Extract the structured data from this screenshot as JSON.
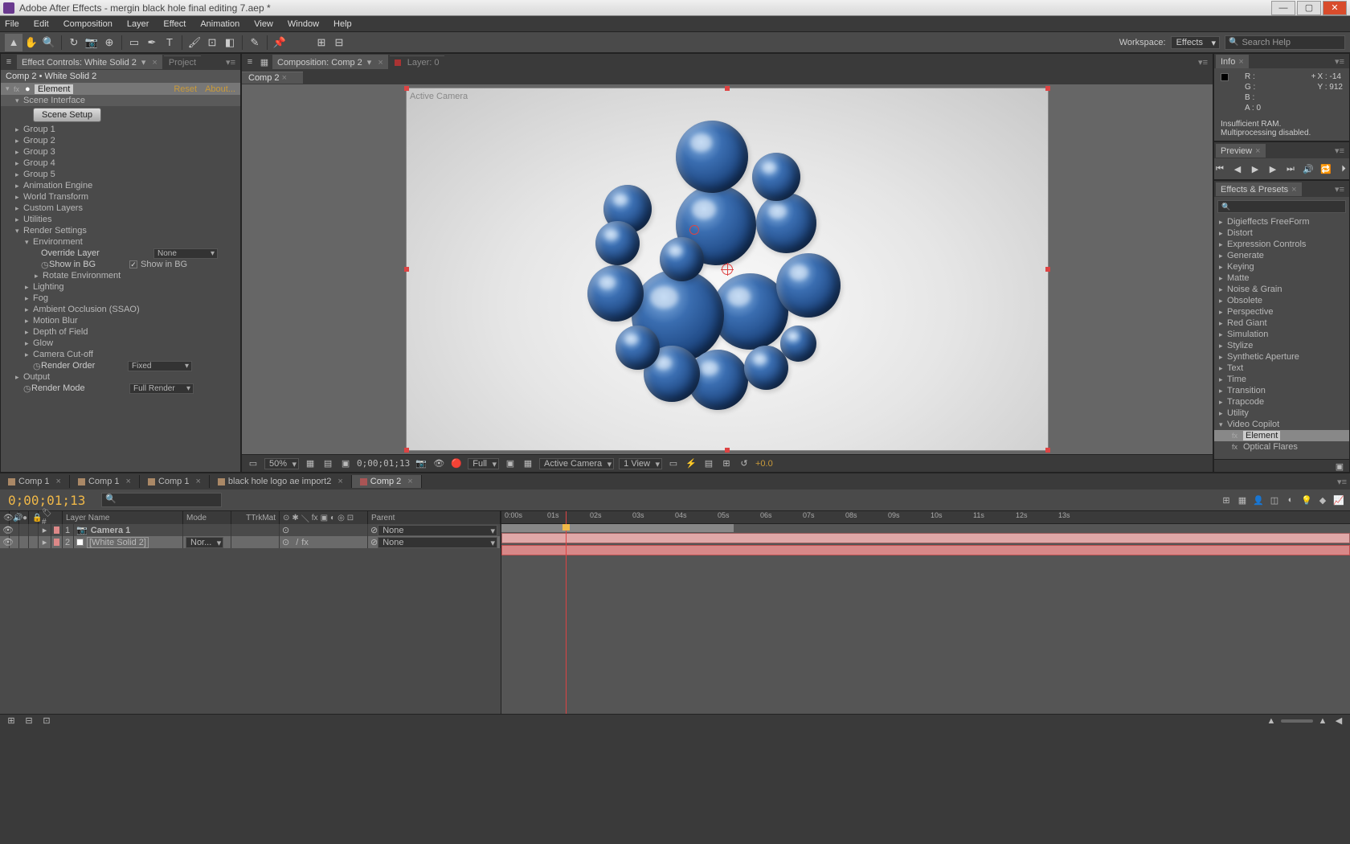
{
  "app": {
    "title": "Adobe After Effects - mergin black hole final editing 7.aep *"
  },
  "menu": [
    "File",
    "Edit",
    "Composition",
    "Layer",
    "Effect",
    "Animation",
    "View",
    "Window",
    "Help"
  ],
  "workspace": {
    "label": "Workspace:",
    "value": "Effects"
  },
  "search": {
    "placeholder": "Search Help"
  },
  "effctl": {
    "tabTitle": "Effect Controls: White Solid 2",
    "projectTab": "Project",
    "breadcrumb": "Comp 2 • White Solid 2",
    "effectName": "Element",
    "reset": "Reset",
    "about": "About...",
    "sceneInterface": "Scene Interface",
    "sceneSetup": "Scene Setup",
    "groups": [
      "Group 1",
      "Group 2",
      "Group 3",
      "Group 4",
      "Group 5"
    ],
    "props": [
      "Animation Engine",
      "World Transform",
      "Custom Layers",
      "Utilities"
    ],
    "renderSettings": "Render Settings",
    "environment": "Environment",
    "overrideLayer": "Override Layer",
    "overrideLayerVal": "None",
    "showInBG": "Show in BG",
    "showInBGVal": "Show in BG",
    "rotateEnv": "Rotate Environment",
    "rs_items": [
      "Lighting",
      "Fog",
      "Ambient Occlusion (SSAO)",
      "Motion Blur",
      "Depth of Field",
      "Glow",
      "Camera Cut-off"
    ],
    "renderOrder": "Render Order",
    "renderOrderVal": "Fixed",
    "output": "Output",
    "renderMode": "Render Mode",
    "renderModeVal": "Full Render"
  },
  "comp": {
    "tabTitle": "Composition: Comp 2",
    "layerTab": "Layer:  0",
    "subTab": "Comp 2",
    "activeCamera": "Active Camera",
    "zoom": "50%",
    "timecode": "0;00;01;13",
    "resolution": "Full",
    "view": "Active Camera",
    "viewLayout": "1 View",
    "exposure": "+0.0"
  },
  "info": {
    "tab": "Info",
    "r": "R :",
    "g": "G :",
    "b": "B :",
    "a": "A :  0",
    "x": "X : -14",
    "y": "Y : 912",
    "msg1": "Insufficient RAM.",
    "msg2": "Multiprocessing disabled."
  },
  "preview": {
    "tab": "Preview"
  },
  "ep": {
    "tab": "Effects & Presets",
    "items": [
      "Digieffects FreeForm",
      "Distort",
      "Expression Controls",
      "Generate",
      "Keying",
      "Matte",
      "Noise & Grain",
      "Obsolete",
      "Perspective",
      "Red Giant",
      "Simulation",
      "Stylize",
      "Synthetic Aperture",
      "Text",
      "Time",
      "Transition",
      "Trapcode",
      "Utility"
    ],
    "videoCopilot": "Video Copilot",
    "element": "Element",
    "opticalFlares": "Optical Flares"
  },
  "timeline": {
    "tabs": [
      "Comp 1",
      "Comp 1",
      "Comp 1",
      "black hole logo ae import2",
      "Comp 2"
    ],
    "activeTab": 4,
    "timecode": "0;00;01;13",
    "cols": {
      "layerName": "Layer Name",
      "mode": "Mode",
      "trkMat": "TrkMat",
      "parent": "Parent"
    },
    "layers": [
      {
        "num": "1",
        "name": "Camera 1",
        "parent": "None"
      },
      {
        "num": "2",
        "name": "[White Solid 2]",
        "mode": "Nor...",
        "parent": "None",
        "selected": true
      }
    ],
    "ruler": [
      "0:00s",
      "01s",
      "02s",
      "03s",
      "04s",
      "05s",
      "06s",
      "07s",
      "08s",
      "09s",
      "10s",
      "11s",
      "12s",
      "13s"
    ]
  }
}
